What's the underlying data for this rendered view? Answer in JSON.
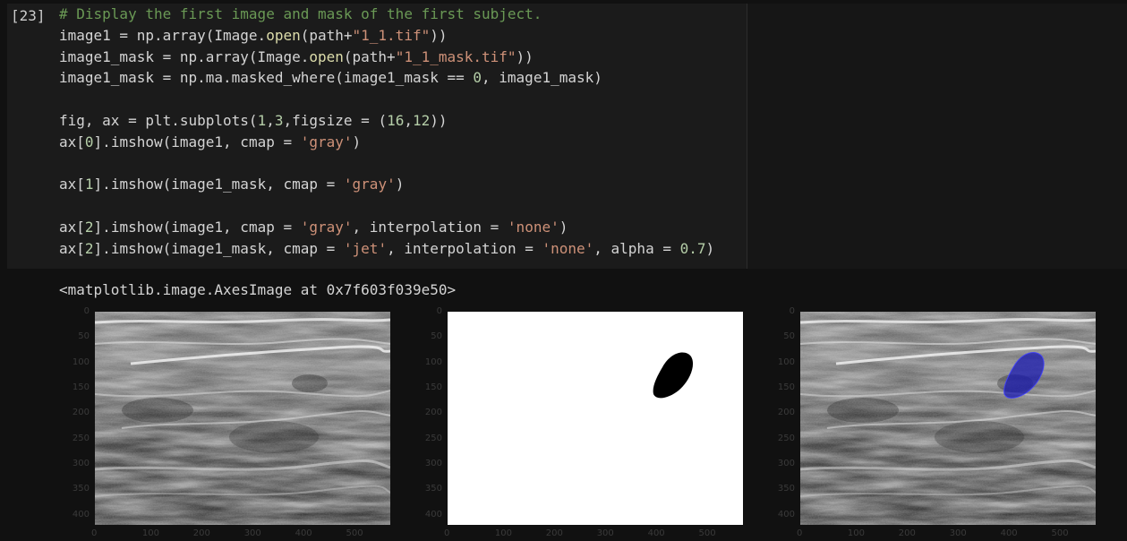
{
  "cell": {
    "prompt": "[23]",
    "code_lines": [
      [
        {
          "t": "# Display the first image and mask of the first subject.",
          "c": "comment"
        }
      ],
      [
        {
          "t": "image1 = np.array(Image.",
          "c": "plain"
        },
        {
          "t": "open",
          "c": "func"
        },
        {
          "t": "(path+",
          "c": "plain"
        },
        {
          "t": "\"1_1.tif\"",
          "c": "str"
        },
        {
          "t": "))",
          "c": "plain"
        }
      ],
      [
        {
          "t": "image1_mask = np.array(Image.",
          "c": "plain"
        },
        {
          "t": "open",
          "c": "func"
        },
        {
          "t": "(path+",
          "c": "plain"
        },
        {
          "t": "\"1_1_mask.tif\"",
          "c": "str"
        },
        {
          "t": "))",
          "c": "plain"
        }
      ],
      [
        {
          "t": "image1_mask = np.ma.masked_where(image1_mask == ",
          "c": "plain"
        },
        {
          "t": "0",
          "c": "num"
        },
        {
          "t": ", image1_mask)",
          "c": "plain"
        }
      ],
      [],
      [
        {
          "t": "fig, ax = plt.subplots(",
          "c": "plain"
        },
        {
          "t": "1",
          "c": "num"
        },
        {
          "t": ",",
          "c": "plain"
        },
        {
          "t": "3",
          "c": "num"
        },
        {
          "t": ",figsize = (",
          "c": "plain"
        },
        {
          "t": "16",
          "c": "num"
        },
        {
          "t": ",",
          "c": "plain"
        },
        {
          "t": "12",
          "c": "num"
        },
        {
          "t": "))",
          "c": "plain"
        }
      ],
      [
        {
          "t": "ax[",
          "c": "plain"
        },
        {
          "t": "0",
          "c": "num"
        },
        {
          "t": "].imshow(image1, cmap = ",
          "c": "plain"
        },
        {
          "t": "'gray'",
          "c": "str"
        },
        {
          "t": ")",
          "c": "plain"
        }
      ],
      [],
      [
        {
          "t": "ax[",
          "c": "plain"
        },
        {
          "t": "1",
          "c": "num"
        },
        {
          "t": "].imshow(image1_mask, cmap = ",
          "c": "plain"
        },
        {
          "t": "'gray'",
          "c": "str"
        },
        {
          "t": ")",
          "c": "plain"
        }
      ],
      [],
      [
        {
          "t": "ax[",
          "c": "plain"
        },
        {
          "t": "2",
          "c": "num"
        },
        {
          "t": "].imshow(image1, cmap = ",
          "c": "plain"
        },
        {
          "t": "'gray'",
          "c": "str"
        },
        {
          "t": ", interpolation = ",
          "c": "plain"
        },
        {
          "t": "'none'",
          "c": "str"
        },
        {
          "t": ")",
          "c": "plain"
        }
      ],
      [
        {
          "t": "ax[",
          "c": "plain"
        },
        {
          "t": "2",
          "c": "num"
        },
        {
          "t": "].imshow(image1_mask, cmap = ",
          "c": "plain"
        },
        {
          "t": "'jet'",
          "c": "str"
        },
        {
          "t": ", interpolation = ",
          "c": "plain"
        },
        {
          "t": "'none'",
          "c": "str"
        },
        {
          "t": ", alpha = ",
          "c": "plain"
        },
        {
          "t": "0.7",
          "c": "num"
        },
        {
          "t": ")",
          "c": "plain"
        }
      ]
    ],
    "output": "<matplotlib.image.AxesImage at 0x7f603f039e50>"
  },
  "plots": {
    "y_ticks": [
      "0",
      "50",
      "100",
      "150",
      "200",
      "250",
      "300",
      "350",
      "400"
    ],
    "x_ticks": [
      "0",
      "100",
      "200",
      "300",
      "400",
      "500"
    ],
    "panels": [
      {
        "name": "ultrasound-image",
        "kind": "ultrasound"
      },
      {
        "name": "mask-image",
        "kind": "mask"
      },
      {
        "name": "overlay-image",
        "kind": "overlay"
      }
    ]
  },
  "colors": {
    "background": "#111111",
    "code_bg": "#1b1b1b",
    "comment": "#6a9955",
    "string": "#ce9178",
    "number": "#b5cea8",
    "function": "#dcdcaa",
    "mask_overlay": "#1a1ab0"
  }
}
